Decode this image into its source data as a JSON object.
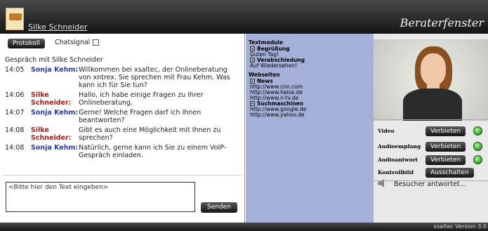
{
  "header": {
    "user_name": "Silke Schneider",
    "window_title": "Beraterfenster"
  },
  "chat": {
    "protocol_button": "Protokoll",
    "chatsignal_label": "Chatsignal",
    "conversation_label": "Gespräch mit Silke Schneider",
    "messages": [
      {
        "time": "14:05",
        "sender": "Sonja Kehm:",
        "sender_color": "#2a3aa8",
        "text": "Willkommen bei xsaltec, der Onlineberatung von xntrex. Sie sprechen mit Frau Kehm. Was kann ich für Sie tun?"
      },
      {
        "time": "14:06",
        "sender": "Silke Schneider:",
        "sender_color": "#a8201c",
        "text": "Hallo, ich habe einige Fragen zu Ihrer Onlineberatung."
      },
      {
        "time": "14:07",
        "sender": "Sonja Kehm:",
        "sender_color": "#2a3aa8",
        "text": "Gerne! Welche Fragen darf ich Ihnen beantworten?"
      },
      {
        "time": "14:08",
        "sender": "Silke Schneider:",
        "sender_color": "#a8201c",
        "text": "Gibt es auch eine Möglichkeit mit Ihnen zu sprechen?"
      },
      {
        "time": "14:08",
        "sender": "Sonja Kehm:",
        "sender_color": "#2a3aa8",
        "text": "Natürlich, gerne kann ich Sie zu einem VoIP-Gespräch einladen."
      }
    ],
    "input_placeholder": "<Bitte hier den Text eingeben>",
    "send_button": "Senden"
  },
  "modules": {
    "textmodule_title": "Textmodule",
    "greeting_title": "Begrüßung",
    "greeting_text": "Guten Tag!",
    "farewell_title": "Verabschiedung",
    "farewell_text": "Auf Wiedersehen!",
    "websites_title": "Webseiten",
    "news_title": "News",
    "news_links": [
      "http://www.cnn.com",
      "http://www.heise.de",
      "http://www.n-tv.de"
    ],
    "search_title": "Suchmaschinen",
    "search_links": [
      "http://www.google.de",
      "http://www.yahoo.de"
    ]
  },
  "controls": {
    "video_label": "Video",
    "video_button": "Verbieten",
    "audio_in_label": "Audioempfang",
    "audio_in_button": "Verbieten",
    "audio_out_label": "Audioantwort",
    "audio_out_button": "Verbieten",
    "control_label": "Kontrollbild",
    "control_button": "Ausschalten",
    "status_text": "Besucher antwortet...",
    "led_color": "#3cb030"
  },
  "footer": {
    "version": "xsaltec Version 3.0"
  }
}
